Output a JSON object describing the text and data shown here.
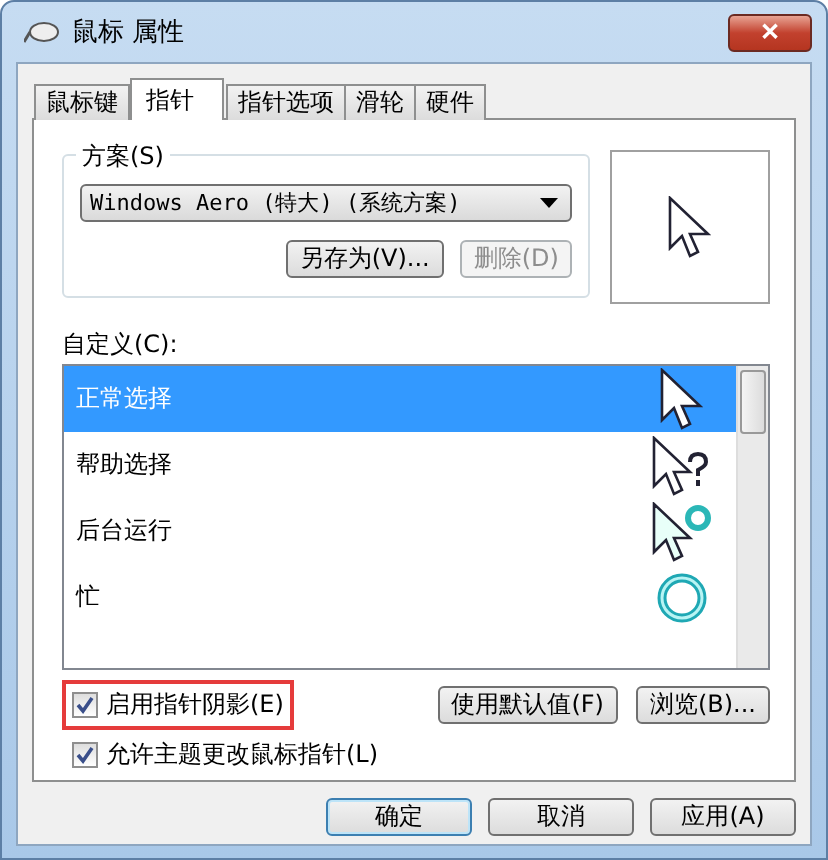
{
  "window": {
    "title": "鼠标 属性",
    "close": "✕"
  },
  "tabs": [
    {
      "label": "鼠标键",
      "selected": false
    },
    {
      "label": "指针",
      "selected": true
    },
    {
      "label": "指针选项",
      "selected": false
    },
    {
      "label": "滑轮",
      "selected": false
    },
    {
      "label": "硬件",
      "selected": false
    }
  ],
  "scheme": {
    "label": "方案(S)",
    "value": "Windows Aero (特大) (系统方案)",
    "buttons": [
      {
        "label": "另存为(V)...",
        "disabled": false
      },
      {
        "label": "删除(D)",
        "disabled": true
      }
    ]
  },
  "customize": {
    "label": "自定义(C):",
    "items": [
      {
        "name": "正常选择",
        "kind": "arrow",
        "selected": true
      },
      {
        "name": "帮助选择",
        "kind": "help",
        "selected": false
      },
      {
        "name": "后台运行",
        "kind": "working",
        "selected": false
      },
      {
        "name": "忙",
        "kind": "busy",
        "selected": false
      }
    ]
  },
  "side_buttons": [
    {
      "label": "使用默认值(F)"
    },
    {
      "label": "浏览(B)..."
    }
  ],
  "checkboxes": [
    {
      "label": "启用指针阴影(E)",
      "checked": true,
      "highlighted": true
    },
    {
      "label": "允许主题更改鼠标指针(L)",
      "checked": true,
      "highlighted": false
    }
  ],
  "footer_buttons": [
    {
      "label": "确定",
      "default": true
    },
    {
      "label": "取消",
      "default": false
    },
    {
      "label": "应用(A)",
      "default": false
    }
  ]
}
